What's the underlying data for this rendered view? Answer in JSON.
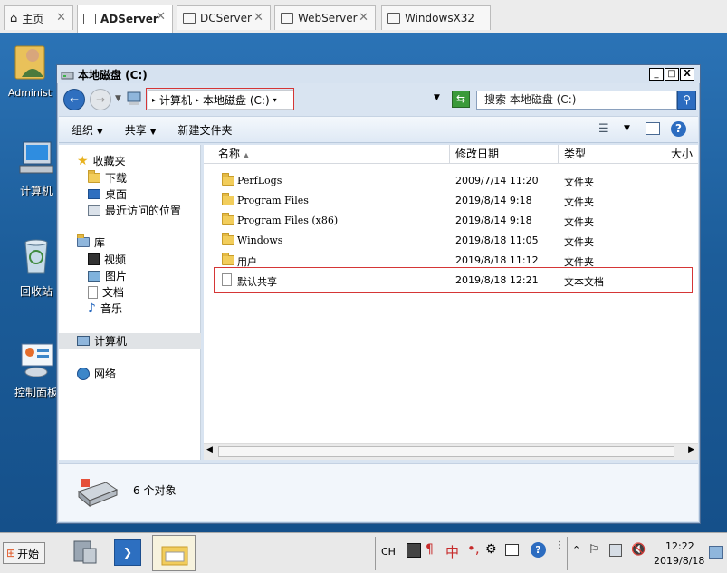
{
  "browser_tabs": [
    {
      "label": "主页",
      "icon": "home-icon",
      "active": false,
      "closable": true
    },
    {
      "label": "ADServer",
      "icon": "vm-icon",
      "active": true,
      "closable": true
    },
    {
      "label": "DCServer",
      "icon": "vm-icon",
      "active": false,
      "closable": true
    },
    {
      "label": "WebServer",
      "icon": "vm-icon",
      "active": false,
      "closable": true
    },
    {
      "label": "WindowsX32",
      "icon": "vm-icon",
      "active": false,
      "closable": false
    }
  ],
  "desktop_icons": [
    {
      "label": "Administ",
      "icon": "user-folder-icon"
    },
    {
      "label": "计算机",
      "icon": "computer-icon"
    },
    {
      "label": "回收站",
      "icon": "recycle-bin-icon"
    },
    {
      "label": "控制面板",
      "icon": "control-panel-icon"
    }
  ],
  "window": {
    "title": "本地磁盘 (C:)",
    "controls": [
      "_",
      "□",
      "X"
    ]
  },
  "address": {
    "breadcrumb": [
      "计算机",
      "本地磁盘 (C:)"
    ],
    "search_placeholder": "搜索 本地磁盘 (C:)"
  },
  "toolbar": {
    "organize": "组织",
    "share": "共享",
    "new_folder": "新建文件夹"
  },
  "nav": {
    "favorites": {
      "label": "收藏夹",
      "items": [
        "下载",
        "桌面",
        "最近访问的位置"
      ]
    },
    "libraries": {
      "label": "库",
      "items": [
        "视频",
        "图片",
        "文档",
        "音乐"
      ]
    },
    "computer": "计算机",
    "network": "网络"
  },
  "columns": {
    "name": "名称",
    "modified": "修改日期",
    "type": "类型",
    "size": "大小"
  },
  "files": [
    {
      "name": "PerfLogs",
      "modified": "2009/7/14 11:20",
      "type": "文件夹",
      "icon": "folder-icon"
    },
    {
      "name": "Program Files",
      "modified": "2019/8/14 9:18",
      "type": "文件夹",
      "icon": "folder-icon"
    },
    {
      "name": "Program Files (x86)",
      "modified": "2019/8/14 9:18",
      "type": "文件夹",
      "icon": "folder-icon"
    },
    {
      "name": "Windows",
      "modified": "2019/8/18 11:05",
      "type": "文件夹",
      "icon": "folder-icon"
    },
    {
      "name": "用户",
      "modified": "2019/8/18 11:12",
      "type": "文件夹",
      "icon": "folder-icon"
    },
    {
      "name": "默认共享",
      "modified": "2019/8/18 12:21",
      "type": "文本文档",
      "icon": "text-file-icon"
    }
  ],
  "details": {
    "count": "6 个对象"
  },
  "taskbar": {
    "start": "开始",
    "ime": "CH",
    "ime_chars": "中",
    "clock_time": "12:22",
    "clock_date": "2019/8/18"
  },
  "colors": {
    "highlight_box": "#d53636",
    "desktop": "#1f5e99",
    "window_frame": "#4a6a93"
  }
}
